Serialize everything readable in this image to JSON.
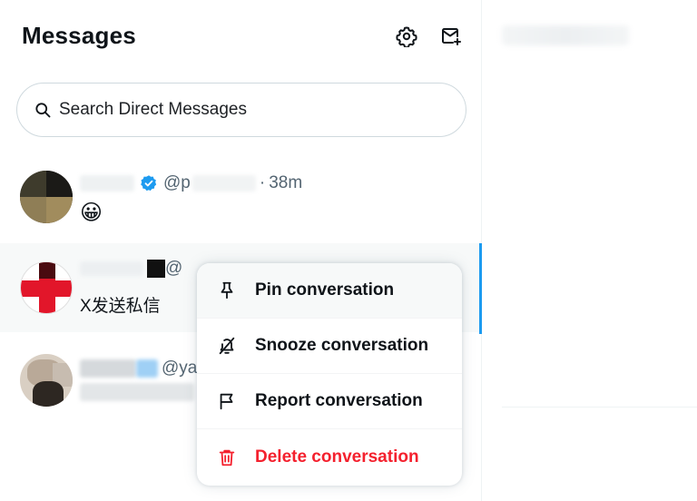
{
  "header": {
    "title": "Messages",
    "settings_icon": "gear-icon",
    "compose_icon": "new-message-icon"
  },
  "search": {
    "placeholder": "Search Direct Messages",
    "icon": "search-icon"
  },
  "conversations": [
    {
      "handle_prefix": "@p",
      "separator": "·",
      "time": "38m",
      "verified": true,
      "preview": "😀"
    },
    {
      "handle_prefix": "@",
      "preview": "X发送私信",
      "active": true
    },
    {
      "handle_prefix": "@ya",
      "verified": true
    }
  ],
  "context_menu": {
    "items": [
      {
        "label": "Pin conversation",
        "icon": "pin-icon"
      },
      {
        "label": "Snooze conversation",
        "icon": "bell-off-icon"
      },
      {
        "label": "Report conversation",
        "icon": "flag-icon"
      },
      {
        "label": "Delete conversation",
        "icon": "trash-icon",
        "danger": true
      }
    ]
  },
  "colors": {
    "accent": "#1d9bf0",
    "danger": "#f4212e",
    "text_primary": "#0f1419",
    "text_secondary": "#536471",
    "border": "#cfd9de"
  }
}
